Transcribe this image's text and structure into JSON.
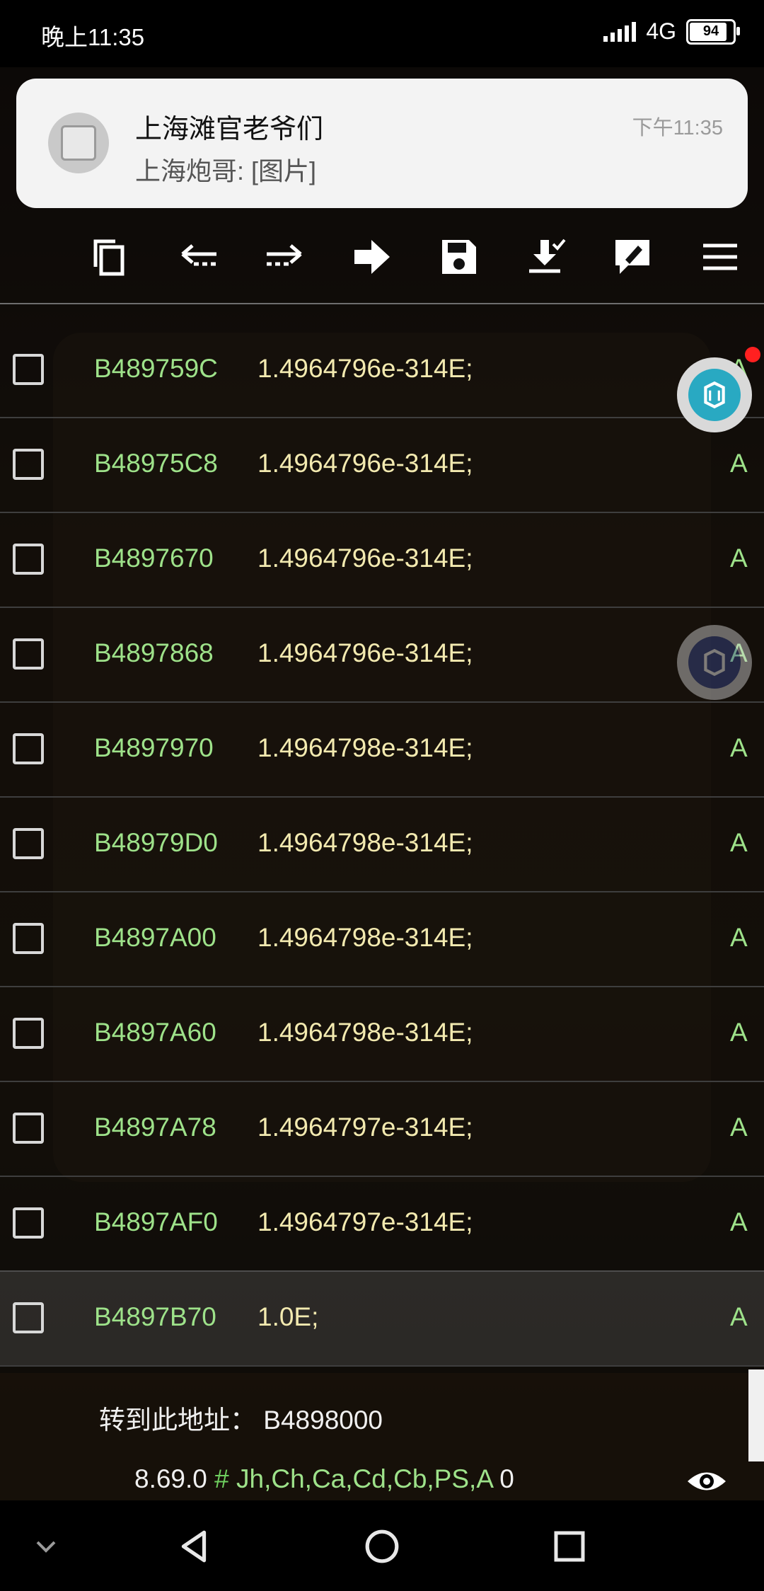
{
  "status_bar": {
    "time": "晚上11:35",
    "network": "4G",
    "battery": "94"
  },
  "notification": {
    "title": "上海滩官老爷们",
    "message": "上海炮哥: [图片]",
    "time": "下午11:35"
  },
  "toolbar": {
    "icons": [
      "copy-icon",
      "back-arrow-icon",
      "forward-arrow-icon",
      "goto-arrow-icon",
      "save-icon",
      "download-icon",
      "edit-icon",
      "menu-icon"
    ]
  },
  "rows": [
    {
      "address": "B489759C",
      "value": "1.4964796e-314E;",
      "type": "A"
    },
    {
      "address": "B48975C8",
      "value": "1.4964796e-314E;",
      "type": "A"
    },
    {
      "address": "B4897670",
      "value": "1.4964796e-314E;",
      "type": "A"
    },
    {
      "address": "B4897868",
      "value": "1.4964796e-314E;",
      "type": "A"
    },
    {
      "address": "B4897970",
      "value": "1.4964798e-314E;",
      "type": "A"
    },
    {
      "address": "B48979D0",
      "value": "1.4964798e-314E;",
      "type": "A"
    },
    {
      "address": "B4897A00",
      "value": "1.4964798e-314E;",
      "type": "A"
    },
    {
      "address": "B4897A60",
      "value": "1.4964798e-314E;",
      "type": "A"
    },
    {
      "address": "B4897A78",
      "value": "1.4964797e-314E;",
      "type": "A"
    },
    {
      "address": "B4897AF0",
      "value": "1.4964797e-314E;",
      "type": "A"
    },
    {
      "address": "B4897B70",
      "value": "1.0E;",
      "type": "A"
    }
  ],
  "goto": {
    "label": "转到此地址：",
    "address": "B4898000"
  },
  "footer": {
    "version": "8.69.0",
    "hash": "#",
    "flags": "Jh,Ch,Ca,Cd,Cb,PS,A",
    "count": "0"
  },
  "colors": {
    "address": "#9ee28a",
    "value": "#f3eab0",
    "accent": "#29a9c2"
  }
}
